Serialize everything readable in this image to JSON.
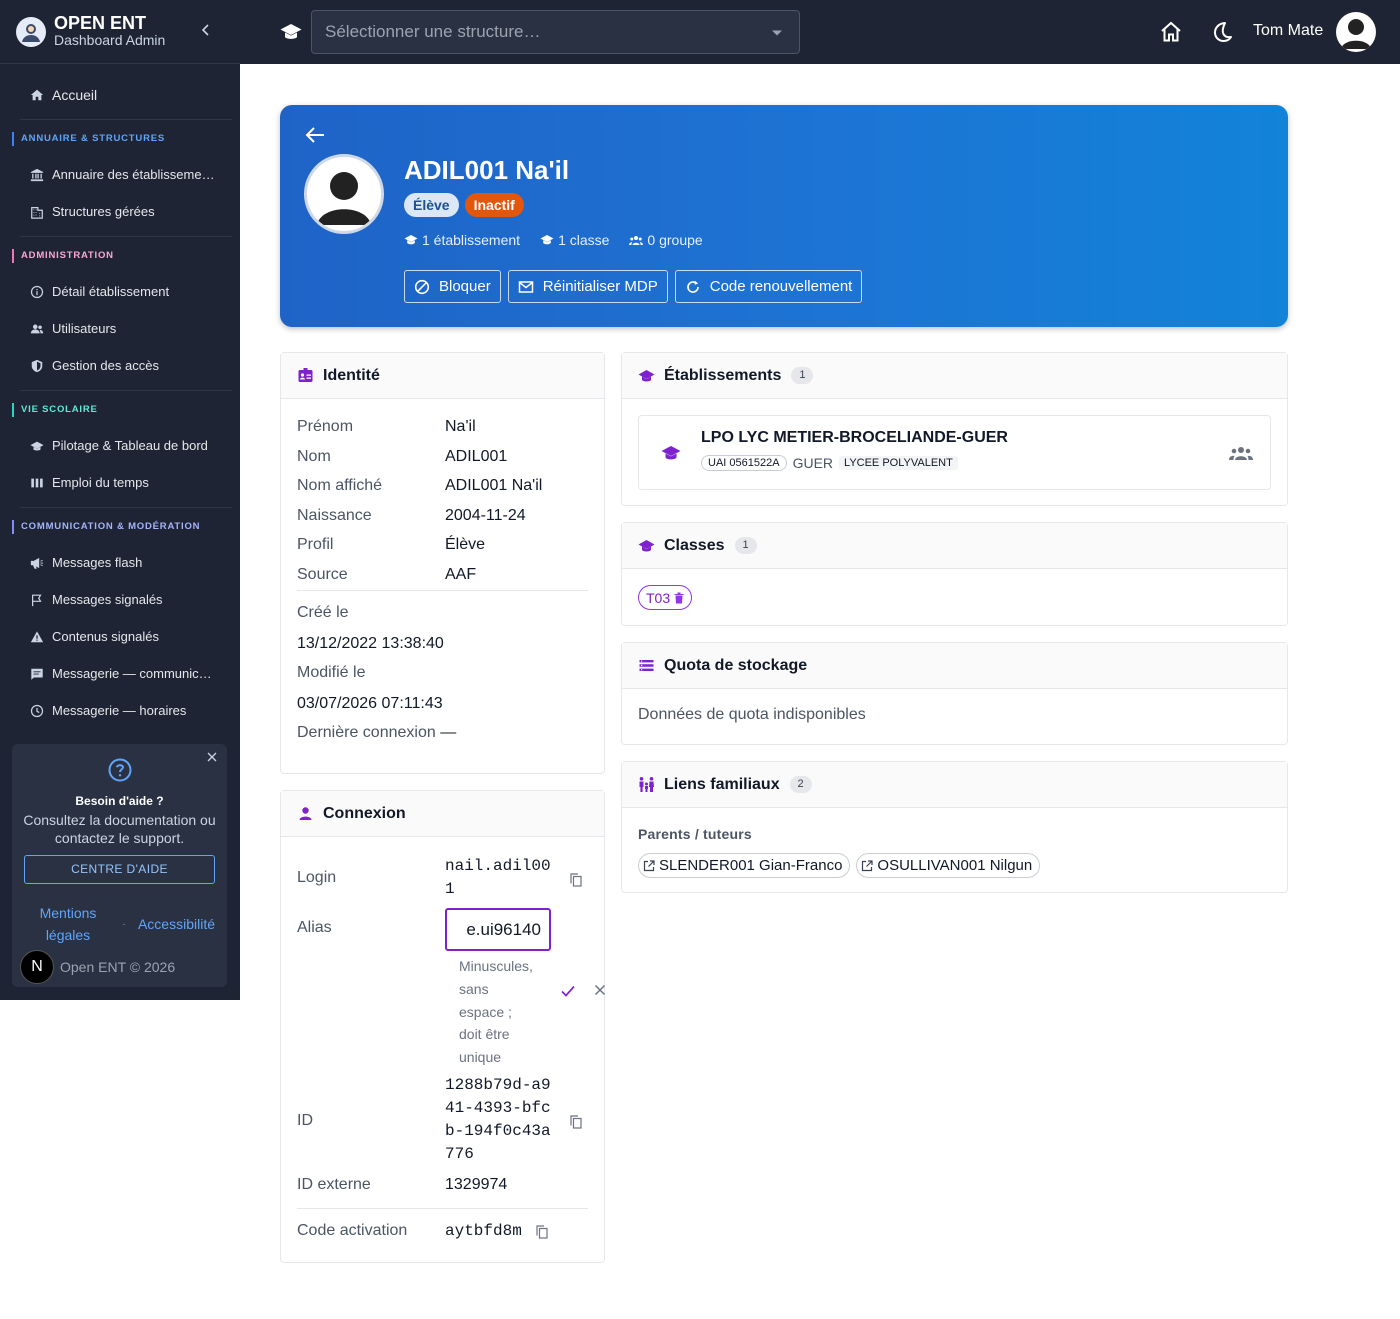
{
  "sidebar": {
    "brand_title": "OPEN ENT",
    "brand_subtitle": "Dashboard Admin",
    "home_label": "Accueil",
    "sections": [
      {
        "title": "ANNUAIRE & STRUCTURES",
        "items": [
          "Annuaire des établissements",
          "Structures gérées"
        ]
      },
      {
        "title": "ADMINISTRATION",
        "items": [
          "Détail établissement",
          "Utilisateurs",
          "Gestion des accès"
        ]
      },
      {
        "title": "VIE SCOLAIRE",
        "items": [
          "Pilotage & Tableau de bord",
          "Emploi du temps"
        ]
      },
      {
        "title": "COMMUNICATION & MODÉRATION",
        "items": [
          "Messages flash",
          "Messages signalés",
          "Contenus signalés",
          "Messagerie — communication",
          "Messagerie — horaires"
        ]
      }
    ],
    "help": {
      "title": "Besoin d'aide ?",
      "text": "Consultez la documentation ou contactez le support.",
      "button": "CENTRE D'AIDE",
      "legal": "Mentions légales",
      "sep": "·",
      "accessibility": "Accessibilité",
      "avatar_letter": "N",
      "copyright": "Open ENT © 2026"
    }
  },
  "topbar": {
    "structure_placeholder": "Sélectionner une structure…",
    "user_name": "Tom Mate"
  },
  "hero": {
    "name": "ADIL001 Na'il",
    "role": "Élève",
    "status": "Inactif",
    "stats": [
      "1 établissement",
      "1 classe",
      "0 groupe"
    ],
    "buttons": [
      "Bloquer",
      "Réinitialiser MDP",
      "Code renouvellement"
    ]
  },
  "identity": {
    "title": "Identité",
    "rows": [
      {
        "k": "Prénom",
        "v": "Na'il"
      },
      {
        "k": "Nom",
        "v": "ADIL001"
      },
      {
        "k": "Nom affiché",
        "v": "ADIL001 Na'il"
      },
      {
        "k": "Naissance",
        "v": "2004-11-24"
      },
      {
        "k": "Profil",
        "v": "Élève"
      },
      {
        "k": "Source",
        "v": "AAF"
      }
    ],
    "created_label": "Créé le",
    "created": "13/12/2022 13:38:40",
    "modified_label": "Modifié le",
    "modified": "03/07/2026 07:11:43",
    "last_login_label": "Dernière connexion",
    "last_login": "—"
  },
  "connexion": {
    "title": "Connexion",
    "login_label": "Login",
    "login_line1": "nail.adil00",
    "login_line2": "1",
    "alias_label": "Alias",
    "alias_value": "e.ui96140",
    "alias_hint": [
      "Minuscules,",
      "sans",
      "espace ;",
      "doit être",
      "unique"
    ],
    "id_label": "ID",
    "id_lines": [
      "1288b79d-a9",
      "41-4393-bfc",
      "b-194f0c43a",
      "776"
    ],
    "extid_label": "ID externe",
    "extid": "1329974",
    "activation_label": "Code activation",
    "activation": "aytbfd8m"
  },
  "etablissements": {
    "title": "Établissements",
    "count": "1",
    "name": "LPO LYC METIER-BROCELIANDE-GUER",
    "uai": "UAI 0561522A",
    "city": "GUER",
    "type": "LYCEE POLYVALENT"
  },
  "classes": {
    "title": "Classes",
    "count": "1",
    "chip": "T03"
  },
  "quota": {
    "title": "Quota de stockage",
    "text": "Données de quota indisponibles"
  },
  "liens": {
    "title": "Liens familiaux",
    "count": "2",
    "subtitle": "Parents / tuteurs",
    "parents": [
      "SLENDER001 Gian-Franco",
      "OSULLIVAN001 Nilgun"
    ]
  },
  "colors": {
    "sidebar_bg": "#1e2433",
    "hero_blue": "#1d74d4",
    "accent_purple": "#7e22ce",
    "inactive_orange": "#e2570b"
  }
}
